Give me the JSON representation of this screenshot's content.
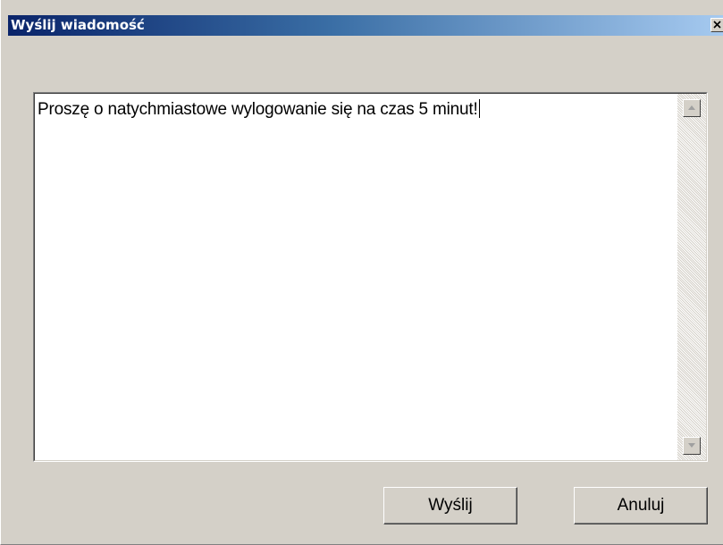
{
  "window": {
    "title": "Wyślij wiadomość"
  },
  "message": {
    "text": "Proszę o natychmiastowe wylogowanie się na czas 5 minut!"
  },
  "buttons": {
    "send_label": "Wyślij",
    "cancel_label": "Anuluj"
  },
  "icons": {
    "close": "close-icon",
    "scroll_up": "scroll-up-arrow-icon",
    "scroll_down": "scroll-down-arrow-icon"
  },
  "colors": {
    "titlebar_start": "#0a246a",
    "titlebar_end": "#a6caf0",
    "dialog_background": "#d4d0c8",
    "text_background": "#ffffff"
  }
}
